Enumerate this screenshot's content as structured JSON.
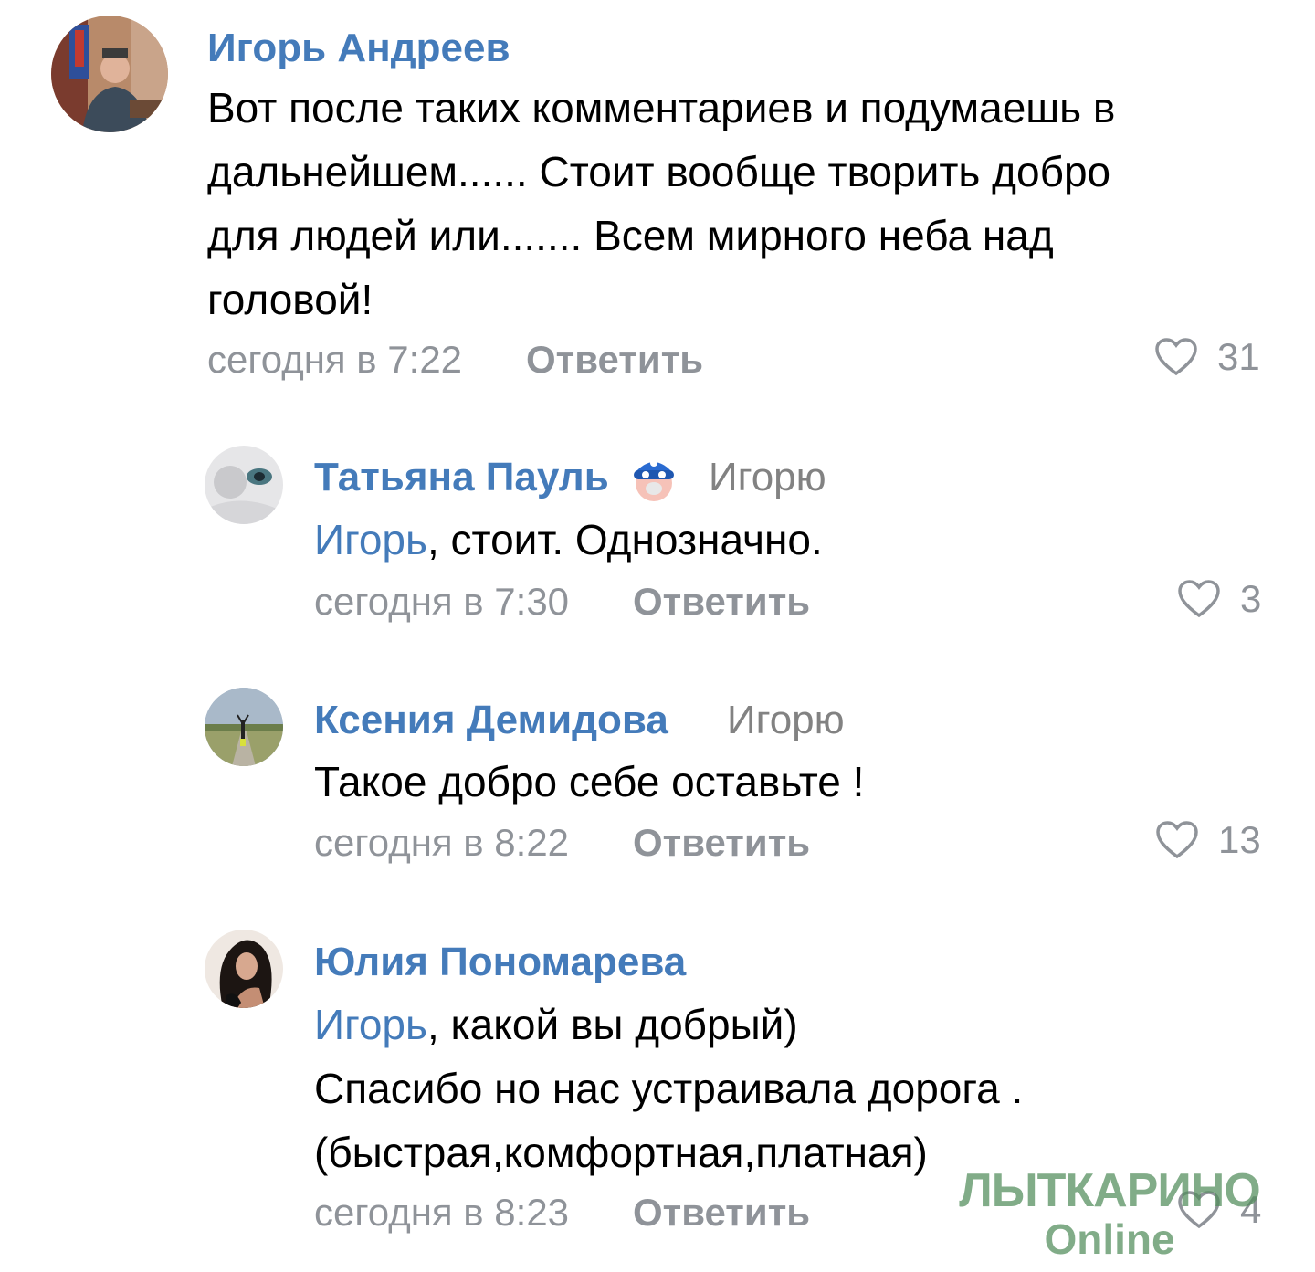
{
  "comments": [
    {
      "author": "Игорь Андреев",
      "text": "Вот после таких комментариев и подумаешь в\nдальнейшем...... Стоит вообще творить добро\nдля людей или....... Всем мирного неба над\nголовой!",
      "time": "сегодня в 7:22",
      "reply_label": "Ответить",
      "likes": "31"
    },
    {
      "author": "Татьяна Пауль",
      "reply_to": "Игорю",
      "mention": "Игорь",
      "text": ", стоит. Однозначно.",
      "time": "сегодня в 7:30",
      "reply_label": "Ответить",
      "likes": "3"
    },
    {
      "author": "Ксения Демидова",
      "reply_to": "Игорю",
      "text": "Такое добро себе оставьте !",
      "time": "сегодня в 8:22",
      "reply_label": "Ответить",
      "likes": "13"
    },
    {
      "author": "Юлия Пономарева",
      "mention": "Игорь",
      "text": ", какой вы добрый)\nСпасибо но нас устраивала дорога .\n(быстрая,комфортная,платная)",
      "time": "сегодня в 8:23",
      "reply_label": "Ответить",
      "likes": "4"
    }
  ],
  "watermark": {
    "line1": "ЛЫТКАРИНО",
    "line2": "Online"
  },
  "colors": {
    "author": "#447bba",
    "meta": "#8f9399",
    "text": "#000000"
  }
}
